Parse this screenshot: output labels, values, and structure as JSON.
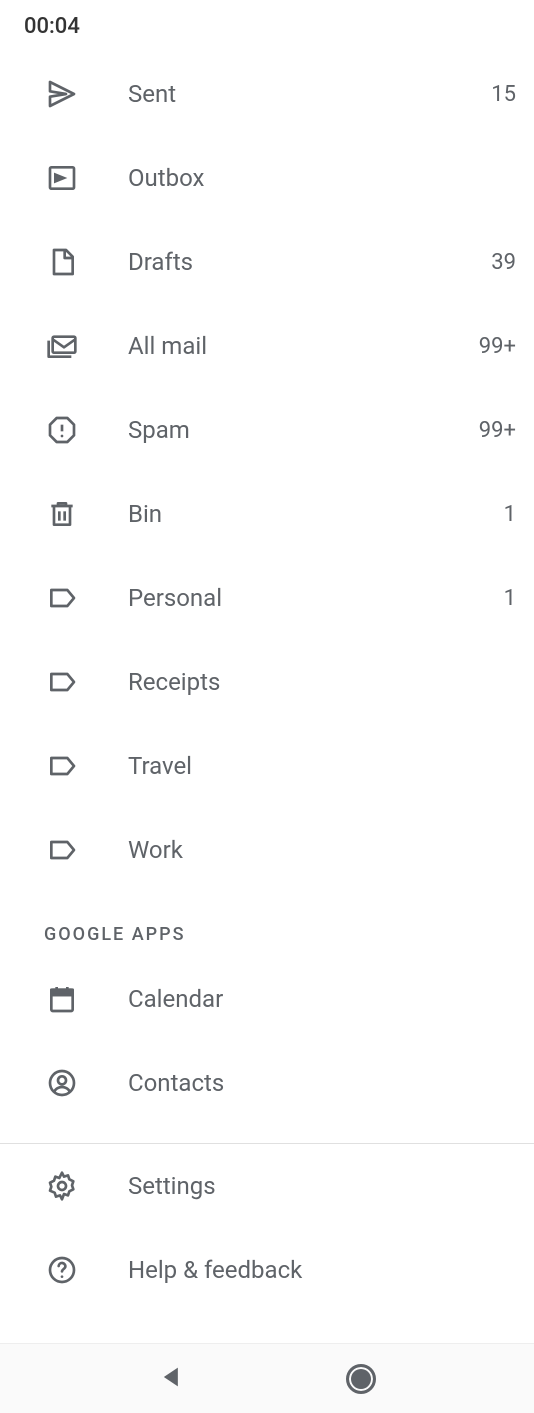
{
  "status": {
    "time": "00:04"
  },
  "items": [
    {
      "icon": "sent-icon",
      "label": "Sent",
      "count": "15"
    },
    {
      "icon": "outbox-icon",
      "label": "Outbox",
      "count": ""
    },
    {
      "icon": "drafts-icon",
      "label": "Drafts",
      "count": "39"
    },
    {
      "icon": "all-mail-icon",
      "label": "All mail",
      "count": "99+"
    },
    {
      "icon": "spam-icon",
      "label": "Spam",
      "count": "99+"
    },
    {
      "icon": "bin-icon",
      "label": "Bin",
      "count": "1"
    },
    {
      "icon": "label-icon",
      "label": "Personal",
      "count": "1"
    },
    {
      "icon": "label-icon",
      "label": "Receipts",
      "count": ""
    },
    {
      "icon": "label-icon",
      "label": "Travel",
      "count": ""
    },
    {
      "icon": "label-icon",
      "label": "Work",
      "count": ""
    }
  ],
  "sections": {
    "google_apps": "GOOGLE APPS"
  },
  "google_apps": [
    {
      "icon": "calendar-icon",
      "label": "Calendar"
    },
    {
      "icon": "contacts-icon",
      "label": "Contacts"
    }
  ],
  "footer": [
    {
      "icon": "settings-icon",
      "label": "Settings"
    },
    {
      "icon": "help-icon",
      "label": "Help & feedback"
    }
  ]
}
